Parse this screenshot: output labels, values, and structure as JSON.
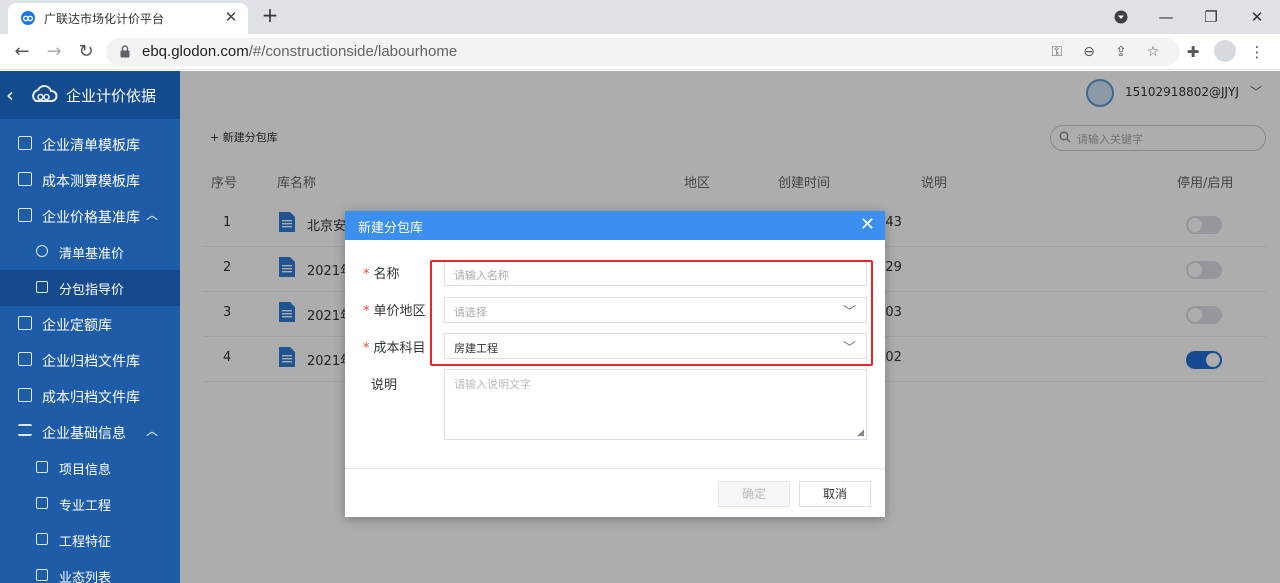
{
  "browser": {
    "tab_title": "广联达市场化计价平台",
    "url_host": "ebq.glodon.com",
    "url_path": "/#/constructionside/labourhome"
  },
  "sidebar": {
    "title": "企业计价依据",
    "items": [
      {
        "label": "企业清单模板库",
        "icon": "list-icon"
      },
      {
        "label": "成本测算模板库",
        "icon": "calc-icon"
      },
      {
        "label": "企业价格基准库",
        "icon": "monitor-icon",
        "caret": "^"
      },
      {
        "label": "清单基准价",
        "icon": "yen-icon"
      },
      {
        "label": "分包指导价",
        "icon": "doc-icon"
      },
      {
        "label": "企业定额库",
        "icon": "book-icon"
      },
      {
        "label": "企业归档文件库",
        "icon": "archive-icon"
      },
      {
        "label": "成本归档文件库",
        "icon": "archive-icon"
      },
      {
        "label": "企业基础信息",
        "icon": "menu-icon",
        "caret": "^"
      },
      {
        "label": "项目信息",
        "icon": "folder-icon"
      },
      {
        "label": "专业工程",
        "icon": "monitor-icon"
      },
      {
        "label": "工程特征",
        "icon": "frame-icon"
      },
      {
        "label": "业态列表",
        "icon": "list-icon"
      }
    ]
  },
  "header": {
    "user": "15102918802@JJYJ"
  },
  "toolbar": {
    "add_label": "+ 新建分包库",
    "search_placeholder": "请输入关键字"
  },
  "table": {
    "headers": [
      "序号",
      "库名称",
      "地区",
      "创建时间",
      "说明",
      "停用/启用"
    ],
    "rows": [
      {
        "no": "1",
        "name": "北京安",
        "time": ":43",
        "enabled": false
      },
      {
        "no": "2",
        "name": "2021年",
        "time": ":29",
        "enabled": false
      },
      {
        "no": "3",
        "name": "2021年",
        "time": ":03",
        "enabled": false
      },
      {
        "no": "4",
        "name": "2021年",
        "time": ":02",
        "enabled": true
      }
    ]
  },
  "dialog": {
    "title": "新建分包库",
    "fields": {
      "name_label": "名称",
      "name_placeholder": "请输入名称",
      "region_label": "单价地区",
      "region_placeholder": "请选择",
      "cost_label": "成本科目",
      "cost_value": "房建工程",
      "desc_label": "说明",
      "desc_placeholder": "请输入说明文字"
    },
    "required_mark": "*",
    "ok_label": "确定",
    "cancel_label": "取消"
  },
  "colors": {
    "sidebar": "#1e5ca8",
    "dialog_header": "#3b8ff0",
    "highlight": "#e8252a",
    "toggle_on": "#1e6fd9"
  }
}
